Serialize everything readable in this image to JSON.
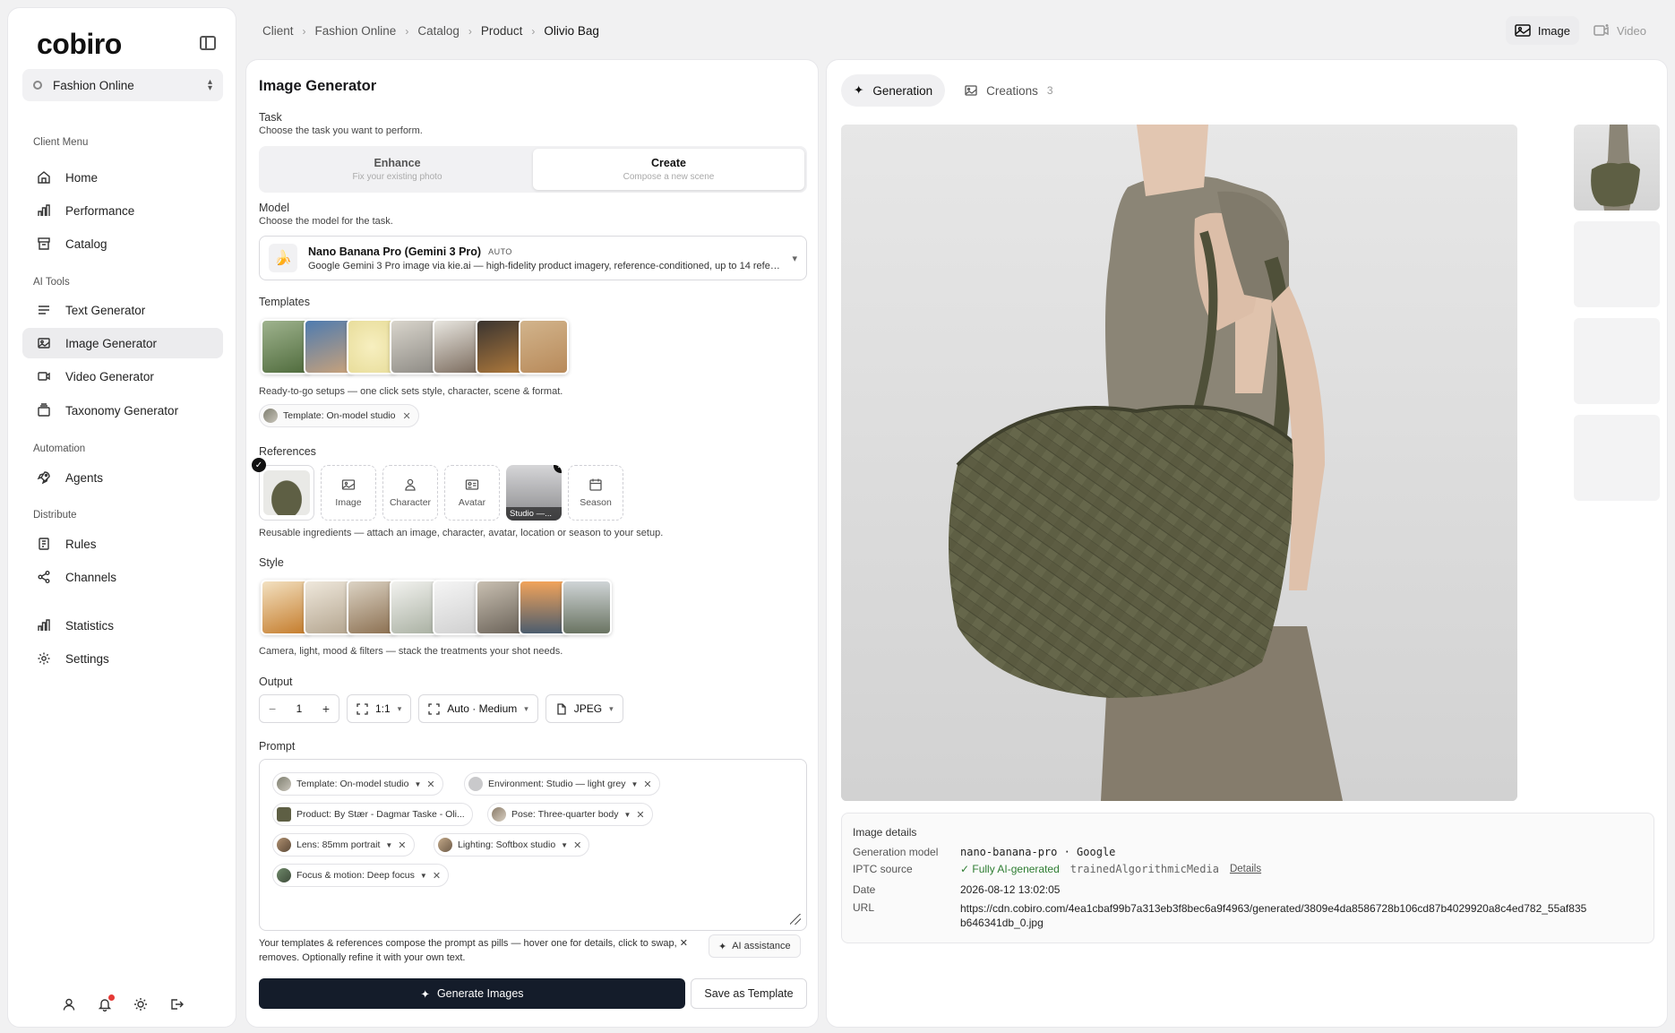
{
  "sidebar": {
    "logo": "cobiro",
    "client": "Fashion Online",
    "sections": {
      "client_menu": "Client Menu",
      "ai_tools": "AI Tools",
      "automation": "Automation",
      "distribute": "Distribute"
    },
    "items": {
      "home": "Home",
      "performance": "Performance",
      "catalog": "Catalog",
      "text_generator": "Text Generator",
      "image_generator": "Image Generator",
      "video_generator": "Video Generator",
      "taxonomy_generator": "Taxonomy Generator",
      "agents": "Agents",
      "rules": "Rules",
      "channels": "Channels",
      "statistics": "Statistics",
      "settings": "Settings"
    },
    "active_item": "Image Generator"
  },
  "breadcrumb": [
    "Client",
    "Fashion Online",
    "Catalog",
    "Product",
    "Olivio Bag"
  ],
  "media_toggle": {
    "image": "Image",
    "video": "Video",
    "active": "Image"
  },
  "generator": {
    "title": "Image Generator",
    "task": {
      "label": "Task",
      "help": "Choose the task you want to perform.",
      "enhance_title": "Enhance",
      "enhance_sub": "Fix your existing photo",
      "create_title": "Create",
      "create_sub": "Compose a new scene",
      "active": "Create"
    },
    "model": {
      "label": "Model",
      "help": "Choose the model for the task.",
      "name": "Nano Banana Pro (Gemini 3 Pro)",
      "badge": "AUTO",
      "desc": "Google Gemini 3 Pro image via kie.ai — high-fidelity product imagery, reference-conditioned, up to 14 reference images"
    },
    "templates": {
      "label": "Templates",
      "help": "Ready-to-go setups — one click sets style, character, scene & format.",
      "selected_pill": "Template: On-model studio"
    },
    "references": {
      "label": "References",
      "image": "Image",
      "character": "Character",
      "avatar": "Avatar",
      "studio_caption": "Studio —...",
      "season": "Season",
      "help": "Reusable ingredients — attach an image, character, avatar, location or season to your setup."
    },
    "style": {
      "label": "Style",
      "help": "Camera, light, mood & filters — stack the treatments your shot needs."
    },
    "output": {
      "label": "Output",
      "count": "1",
      "aspect": "1:1",
      "quality": "Auto · Medium",
      "format": "JPEG"
    },
    "prompt": {
      "label": "Prompt",
      "pills": [
        "Template: On-model studio",
        "Environment: Studio — light grey",
        "Product: By Stær - Dagmar Taske - Oli...",
        "Pose: Three-quarter body",
        "Lens: 85mm portrait",
        "Lighting: Softbox studio",
        "Focus & motion: Deep focus"
      ],
      "hint": "Your templates & references compose the prompt as pills — hover one for details, click to swap, ✕ removes. Optionally refine it with your own text.",
      "ai_assistance": "AI assistance"
    },
    "generate_button": "Generate Images",
    "save_template_button": "Save as Template"
  },
  "result": {
    "tabs": {
      "generation": "Generation",
      "creations": "Creations",
      "creations_count": "3"
    },
    "details": {
      "title": "Image details",
      "model_label": "Generation model",
      "model_value": "nano-banana-pro · Google",
      "iptc_label": "IPTC source",
      "iptc_value": "Fully AI-generated",
      "iptc_code": "trainedAlgorithmicMedia",
      "iptc_link": "Details",
      "date_label": "Date",
      "date_value": "2026-08-12 13:02:05",
      "url_label": "URL",
      "url_line1": "https://cdn.cobiro.com/4ea1cbaf99b7a313eb3f8bec6a9f4963/generated/3809e4da8586728b106cd87b4029920a8c4ed782_55af835",
      "url_line2": "b646341db_0.jpg"
    }
  },
  "colors": {
    "primary_button": "#141c2a",
    "ai_generated_green": "#2e7d32",
    "notification_dot": "#e53935",
    "bag_olive": "#5e5f44"
  }
}
